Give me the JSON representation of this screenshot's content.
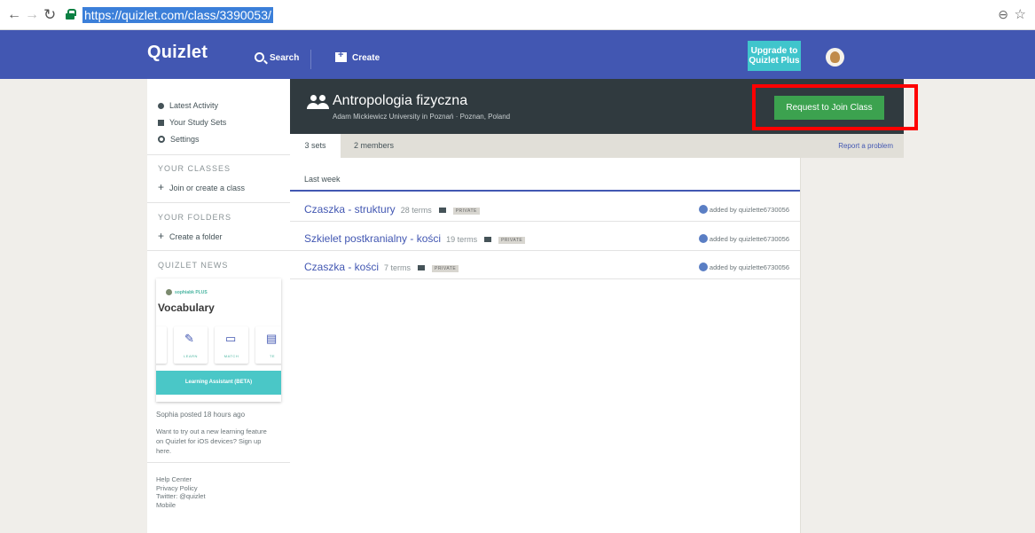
{
  "browser": {
    "url": "https://quizlet.com/class/3390053/"
  },
  "header": {
    "logo": "Quizlet",
    "search_label": "Search",
    "create_label": "Create",
    "upgrade_line1": "Upgrade to",
    "upgrade_line2": "Quizlet Plus"
  },
  "sidebar": {
    "links": [
      "Latest Activity",
      "Your Study Sets",
      "Settings"
    ],
    "classes_heading": "YOUR CLASSES",
    "join_create": "Join or create a class",
    "folders_heading": "YOUR FOLDERS",
    "create_folder": "Create a folder",
    "news_heading": "QUIZLET NEWS",
    "news_card": {
      "author": "sophiabk PLUS",
      "title": "Vocabulary",
      "tiles": [
        "GS",
        "LEARN",
        "MATCH",
        "TE"
      ],
      "banner": "Learning Assistant (BETA)"
    },
    "news_meta": "Sophia posted 18 hours ago",
    "news_desc": "Want to try out a new learning feature on Quizlet for iOS devices? Sign up here.",
    "footer": [
      "Help Center",
      "Privacy Policy",
      "Twitter: @quizlet",
      "Mobile"
    ]
  },
  "class": {
    "title": "Antropologia fizyczna",
    "subtitle": "Adam Mickiewicz University in Poznań · Poznan, Poland",
    "join_button": "Request to Join Class"
  },
  "tabs": {
    "sets": "3 sets",
    "members": "2 members",
    "report": "Report a problem"
  },
  "sets": {
    "group_label": "Last week",
    "rows": [
      {
        "title": "Czaszka - struktury",
        "terms": "28 terms",
        "badge": "PRIVATE",
        "added": "added by quizlette6730056"
      },
      {
        "title": "Szkielet postkranialny - kości",
        "terms": "19 terms",
        "badge": "PRIVATE",
        "added": "added by quizlette6730056"
      },
      {
        "title": "Czaszka - kości",
        "terms": "7 terms",
        "badge": "PRIVATE",
        "added": "added by quizlette6730056"
      }
    ]
  }
}
